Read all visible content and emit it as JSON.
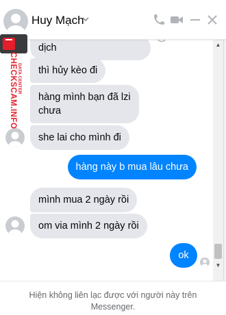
{
  "header": {
    "contact_name": "Huy Mạch",
    "icons": [
      "chevron-down-icon",
      "phone-icon",
      "video-icon",
      "minimize-icon",
      "close-icon"
    ],
    "accent_color": "#0084ff"
  },
  "messages": [
    {
      "direction": "incoming",
      "text": "dịch"
    },
    {
      "direction": "incoming",
      "text": "thì hủy kèo đi"
    },
    {
      "direction": "incoming",
      "lines": [
        "hàng mình bạn đã lzi",
        "chưa"
      ]
    },
    {
      "direction": "incoming",
      "text": "she lai cho mình đi"
    },
    {
      "direction": "outgoing",
      "text": "hàng này b mua lâu chưa"
    },
    {
      "direction": "incoming",
      "text": "mình mua 2 ngày rồi"
    },
    {
      "direction": "incoming",
      "text": "om via mình 2 ngày rồi"
    },
    {
      "direction": "outgoing",
      "text": "ok"
    }
  ],
  "message_actions": [
    "emoji-icon",
    "reply-icon",
    "more-icon"
  ],
  "footer": {
    "notice": "Hiện không liên lạc được với người này trên Messenger."
  },
  "watermark": {
    "brand": "CHECKSCAM.INFO",
    "tagline": "DATA CENTER",
    "colors": {
      "brand": "#e41e2b",
      "badge": "#3a3b3c"
    }
  }
}
